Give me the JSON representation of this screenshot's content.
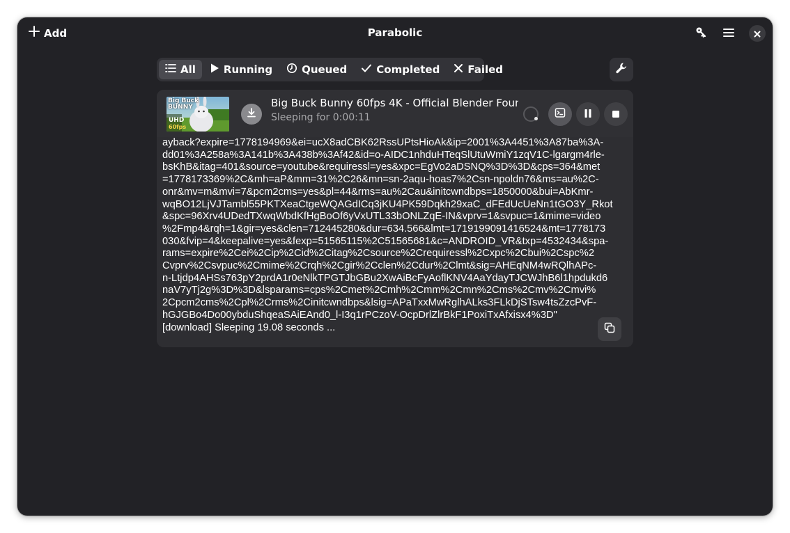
{
  "header": {
    "add_label": "Add",
    "title": "Parabolic",
    "icons": [
      "plus-icon",
      "key-icon",
      "hamburger-menu-icon",
      "close-icon"
    ]
  },
  "filters": {
    "tabs": [
      {
        "label": "All",
        "icon": "list-icon",
        "active": true
      },
      {
        "label": "Running",
        "icon": "play-icon",
        "active": false
      },
      {
        "label": "Queued",
        "icon": "clock-icon",
        "active": false
      },
      {
        "label": "Completed",
        "icon": "checkmark-icon",
        "active": false
      },
      {
        "label": "Failed",
        "icon": "x-icon",
        "active": false
      }
    ],
    "settings_icon": "wrench-icon"
  },
  "download": {
    "thumbnail": {
      "line1": "Big Buck",
      "line2": "BUNNY",
      "badge1": "UHD",
      "badge2": "60fps"
    },
    "title": "Big Buck Bunny 60fps 4K - Official Blender Foun...",
    "status": "Sleeping for 0:00:11",
    "log_lines": [
      "ayback?expire=1778194969&ei=ucX8adCBK62RssUPtsHioAk&ip=2001%3A4451%3A87ba%3A-",
      "dd01%3A258a%3A141b%3A438b%3Af42&id=o-AIDC1nhduHTeqSlUtuWmiY1zqV1C-lgargm4rle-",
      "bsKhB&itag=401&source=youtube&requiressl=yes&xpc=EgVo2aDSNQ%3D%3D&cps=364&met",
      "=1778173369%2C&mh=aP&mm=31%2C26&mn=sn-2aqu-hoas7%2Csn-npoldn76&ms=au%2C-",
      "onr&mv=m&mvi=7&pcm2cms=yes&pl=44&rms=au%2Cau&initcwndbps=1850000&bui=AbKmr-",
      "wqBO12LjVJTambl55PKTXeaCtgeWQAGdICq3jKU4PK59Dqkh29xaC_dFEdUcUeNn1tGO3Y_Rkot",
      "&spc=96Xrv4UDedTXwqWbdKfHgBoOf6yVxUTL33bONLZqE-IN&vprv=1&svpuc=1&mime=video",
      "%2Fmp4&rqh=1&gir=yes&clen=712445280&dur=634.566&lmt=1719199091416524&mt=1778173",
      "030&fvip=4&keepalive=yes&fexp=51565115%2C51565681&c=ANDROID_VR&txp=4532434&spa-",
      "rams=expire%2Cei%2Cip%2Cid%2Citag%2Csource%2Crequiressl%2Cxpc%2Cbui%2Cspc%2",
      "Cvprv%2Csvpuc%2Cmime%2Crqh%2Cgir%2Cclen%2Cdur%2Clmt&sig=AHEqNM4wRQlhAPc-",
      "n-Ltjdp4AHSs763pY2prdA1r0eNlkTPGTJbGBu2XwAiBcFyAoflKNV4AaYdayTJCWJhB6l1hpdukd6",
      "naV7yTj2g%3D%3D&lsparams=cps%2Cmet%2Cmh%2Cmm%2Cmn%2Cms%2Cmv%2Cmvi%",
      "2Cpcm2cms%2Cpl%2Crms%2Cinitcwndbps&lsig=APaTxxMwRglhALks3FLkDjSTsw4tsZzcPvF-",
      "hGJGBo4Do00ybduShqeaSAiEAnd0_l-I3q1rPCzoV-OcpDrlZlrBkF1PoxiTxAfxisx4%3D\"",
      "[download] Sleeping 19.08 seconds ..."
    ],
    "icons": [
      "download-icon",
      "spinner-icon",
      "terminal-icon",
      "pause-icon",
      "stop-icon",
      "copy-icon"
    ]
  }
}
